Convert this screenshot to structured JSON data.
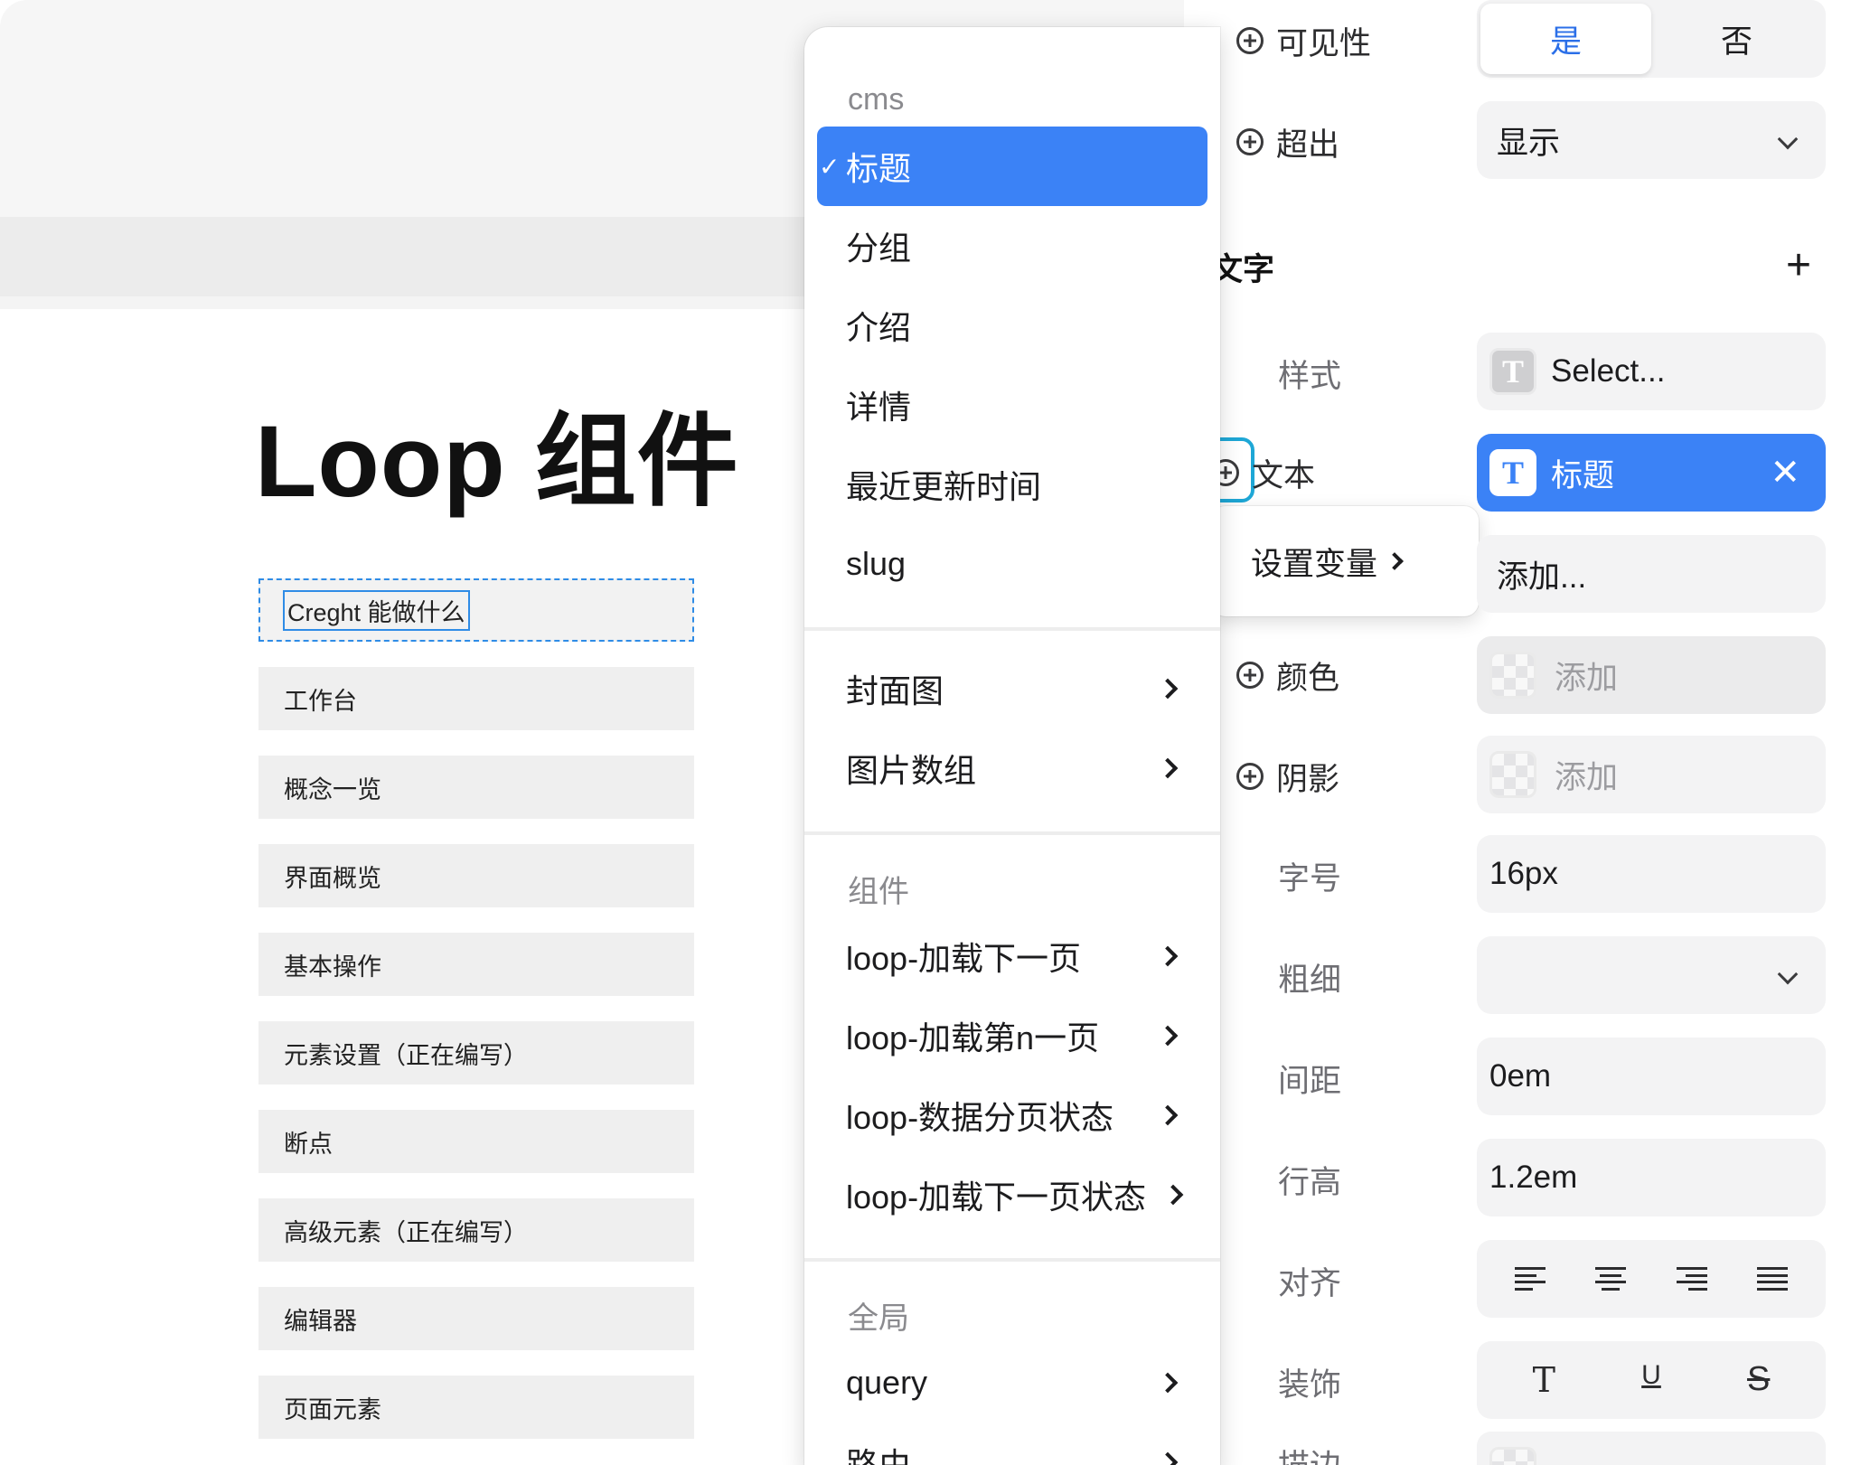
{
  "canvas": {
    "title": "Loop 组件",
    "items": [
      "Creght 能做什么",
      "工作台",
      "概念一览",
      "界面概览",
      "基本操作",
      "元素设置（正在编写）",
      "断点",
      "高级元素（正在编写）",
      "编辑器",
      "页面元素"
    ],
    "selected_index": 0
  },
  "menu": {
    "header": "cms",
    "cms_items": [
      "标题",
      "分组",
      "介绍",
      "详情",
      "最近更新时间",
      "slug"
    ],
    "selected": "标题",
    "check_mark": "✓",
    "media_items": [
      "封面图",
      "图片数组"
    ],
    "components_header": "组件",
    "component_items": [
      "loop-加载下一页",
      "loop-加载第n一页",
      "loop-数据分页状态",
      "loop-加载下一页状态"
    ],
    "global_header": "全局",
    "global_items": [
      "query",
      "路由"
    ]
  },
  "panel": {
    "visibility": {
      "label": "可见性",
      "yes": "是",
      "no": "否",
      "selected": "是"
    },
    "overflow": {
      "label": "超出",
      "value": "显示"
    },
    "text_section": {
      "title": "文字",
      "add": "+"
    },
    "style": {
      "label": "样式",
      "placeholder": "Select...",
      "icon": "T"
    },
    "text": {
      "label": "文本",
      "binding": "标题",
      "icon": "T",
      "clear_icon": "✕"
    },
    "popover": {
      "label": "设置变量"
    },
    "add_field": {
      "value": "添加..."
    },
    "color": {
      "label": "颜色",
      "value": "添加"
    },
    "shadow": {
      "label": "阴影",
      "value": "添加"
    },
    "font_size": {
      "label": "字号",
      "value": "16px"
    },
    "weight": {
      "label": "粗细",
      "value": ""
    },
    "spacing": {
      "label": "间距",
      "value": "0em"
    },
    "line_height": {
      "label": "行高",
      "value": "1.2em"
    },
    "align": {
      "label": "对齐"
    },
    "decoration": {
      "label": "装饰",
      "none": "T",
      "underline": "U",
      "strike": "S"
    },
    "stroke": {
      "label": "描边"
    }
  }
}
